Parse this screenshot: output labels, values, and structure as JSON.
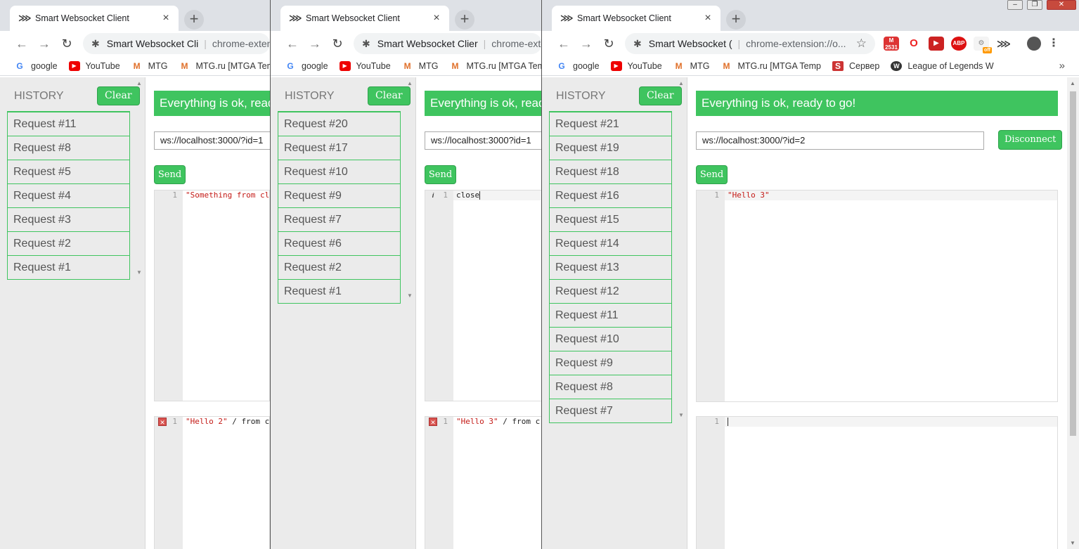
{
  "windows": [
    {
      "tab_title": "Smart Websocket Client",
      "omnibox_site": "Smart Websocket Cli",
      "omnibox_url": "chrome-extensi",
      "history_title": "HISTORY",
      "clear_label": "Clear",
      "requests": [
        "Request #11",
        "Request #8",
        "Request #5",
        "Request #4",
        "Request #3",
        "Request #2",
        "Request #1"
      ],
      "status": "Everything is ok, ready",
      "ws_url": "ws://localhost:3000/?id=1",
      "send_label": "Send",
      "editor_line": "1",
      "editor_text": "\"Something from cl",
      "log_line": "1",
      "log_text_str": "\"Hello 2\"",
      "log_text_rest": " / from c"
    },
    {
      "tab_title": "Smart Websocket Client",
      "omnibox_site": "Smart Websocket Clier",
      "omnibox_url": "chrome-exte",
      "history_title": "HISTORY",
      "clear_label": "Clear",
      "requests": [
        "Request #20",
        "Request #17",
        "Request #10",
        "Request #9",
        "Request #7",
        "Request #6",
        "Request #2",
        "Request #1"
      ],
      "status": "Everything is ok, ready",
      "ws_url": "ws://localhost:3000?id=1",
      "send_label": "Send",
      "editor_line": "1",
      "editor_text": "close",
      "log_line": "1",
      "log_text_str": "\"Hello 3\"",
      "log_text_rest": " / from c"
    },
    {
      "tab_title": "Smart Websocket Client",
      "omnibox_site": "Smart Websocket (",
      "omnibox_url": "chrome-extension://o...",
      "history_title": "HISTORY",
      "clear_label": "Clear",
      "requests": [
        "Request #21",
        "Request #19",
        "Request #18",
        "Request #16",
        "Request #15",
        "Request #14",
        "Request #13",
        "Request #12",
        "Request #11",
        "Request #10",
        "Request #9",
        "Request #8",
        "Request #7"
      ],
      "status": "Everything is ok, ready to go!",
      "ws_url": "ws://localhost:3000/?id=2",
      "disconnect_label": "Disconnect",
      "send_label": "Send",
      "editor_line": "1",
      "editor_text": "\"Hello 3\"",
      "log_line": "1",
      "ext_badge_gmail": "2531",
      "ext_badge_off": "off"
    }
  ],
  "bookmarks": [
    "google",
    "YouTube",
    "MTG",
    "MTG.ru [MTGA Temp",
    "Сервер",
    "League of Legends W"
  ],
  "bookmarks_overflow": "»",
  "colors": {
    "accent": "#3fc45f",
    "tab_strip": "#dee1e6",
    "sidebar": "#ebebeb"
  }
}
